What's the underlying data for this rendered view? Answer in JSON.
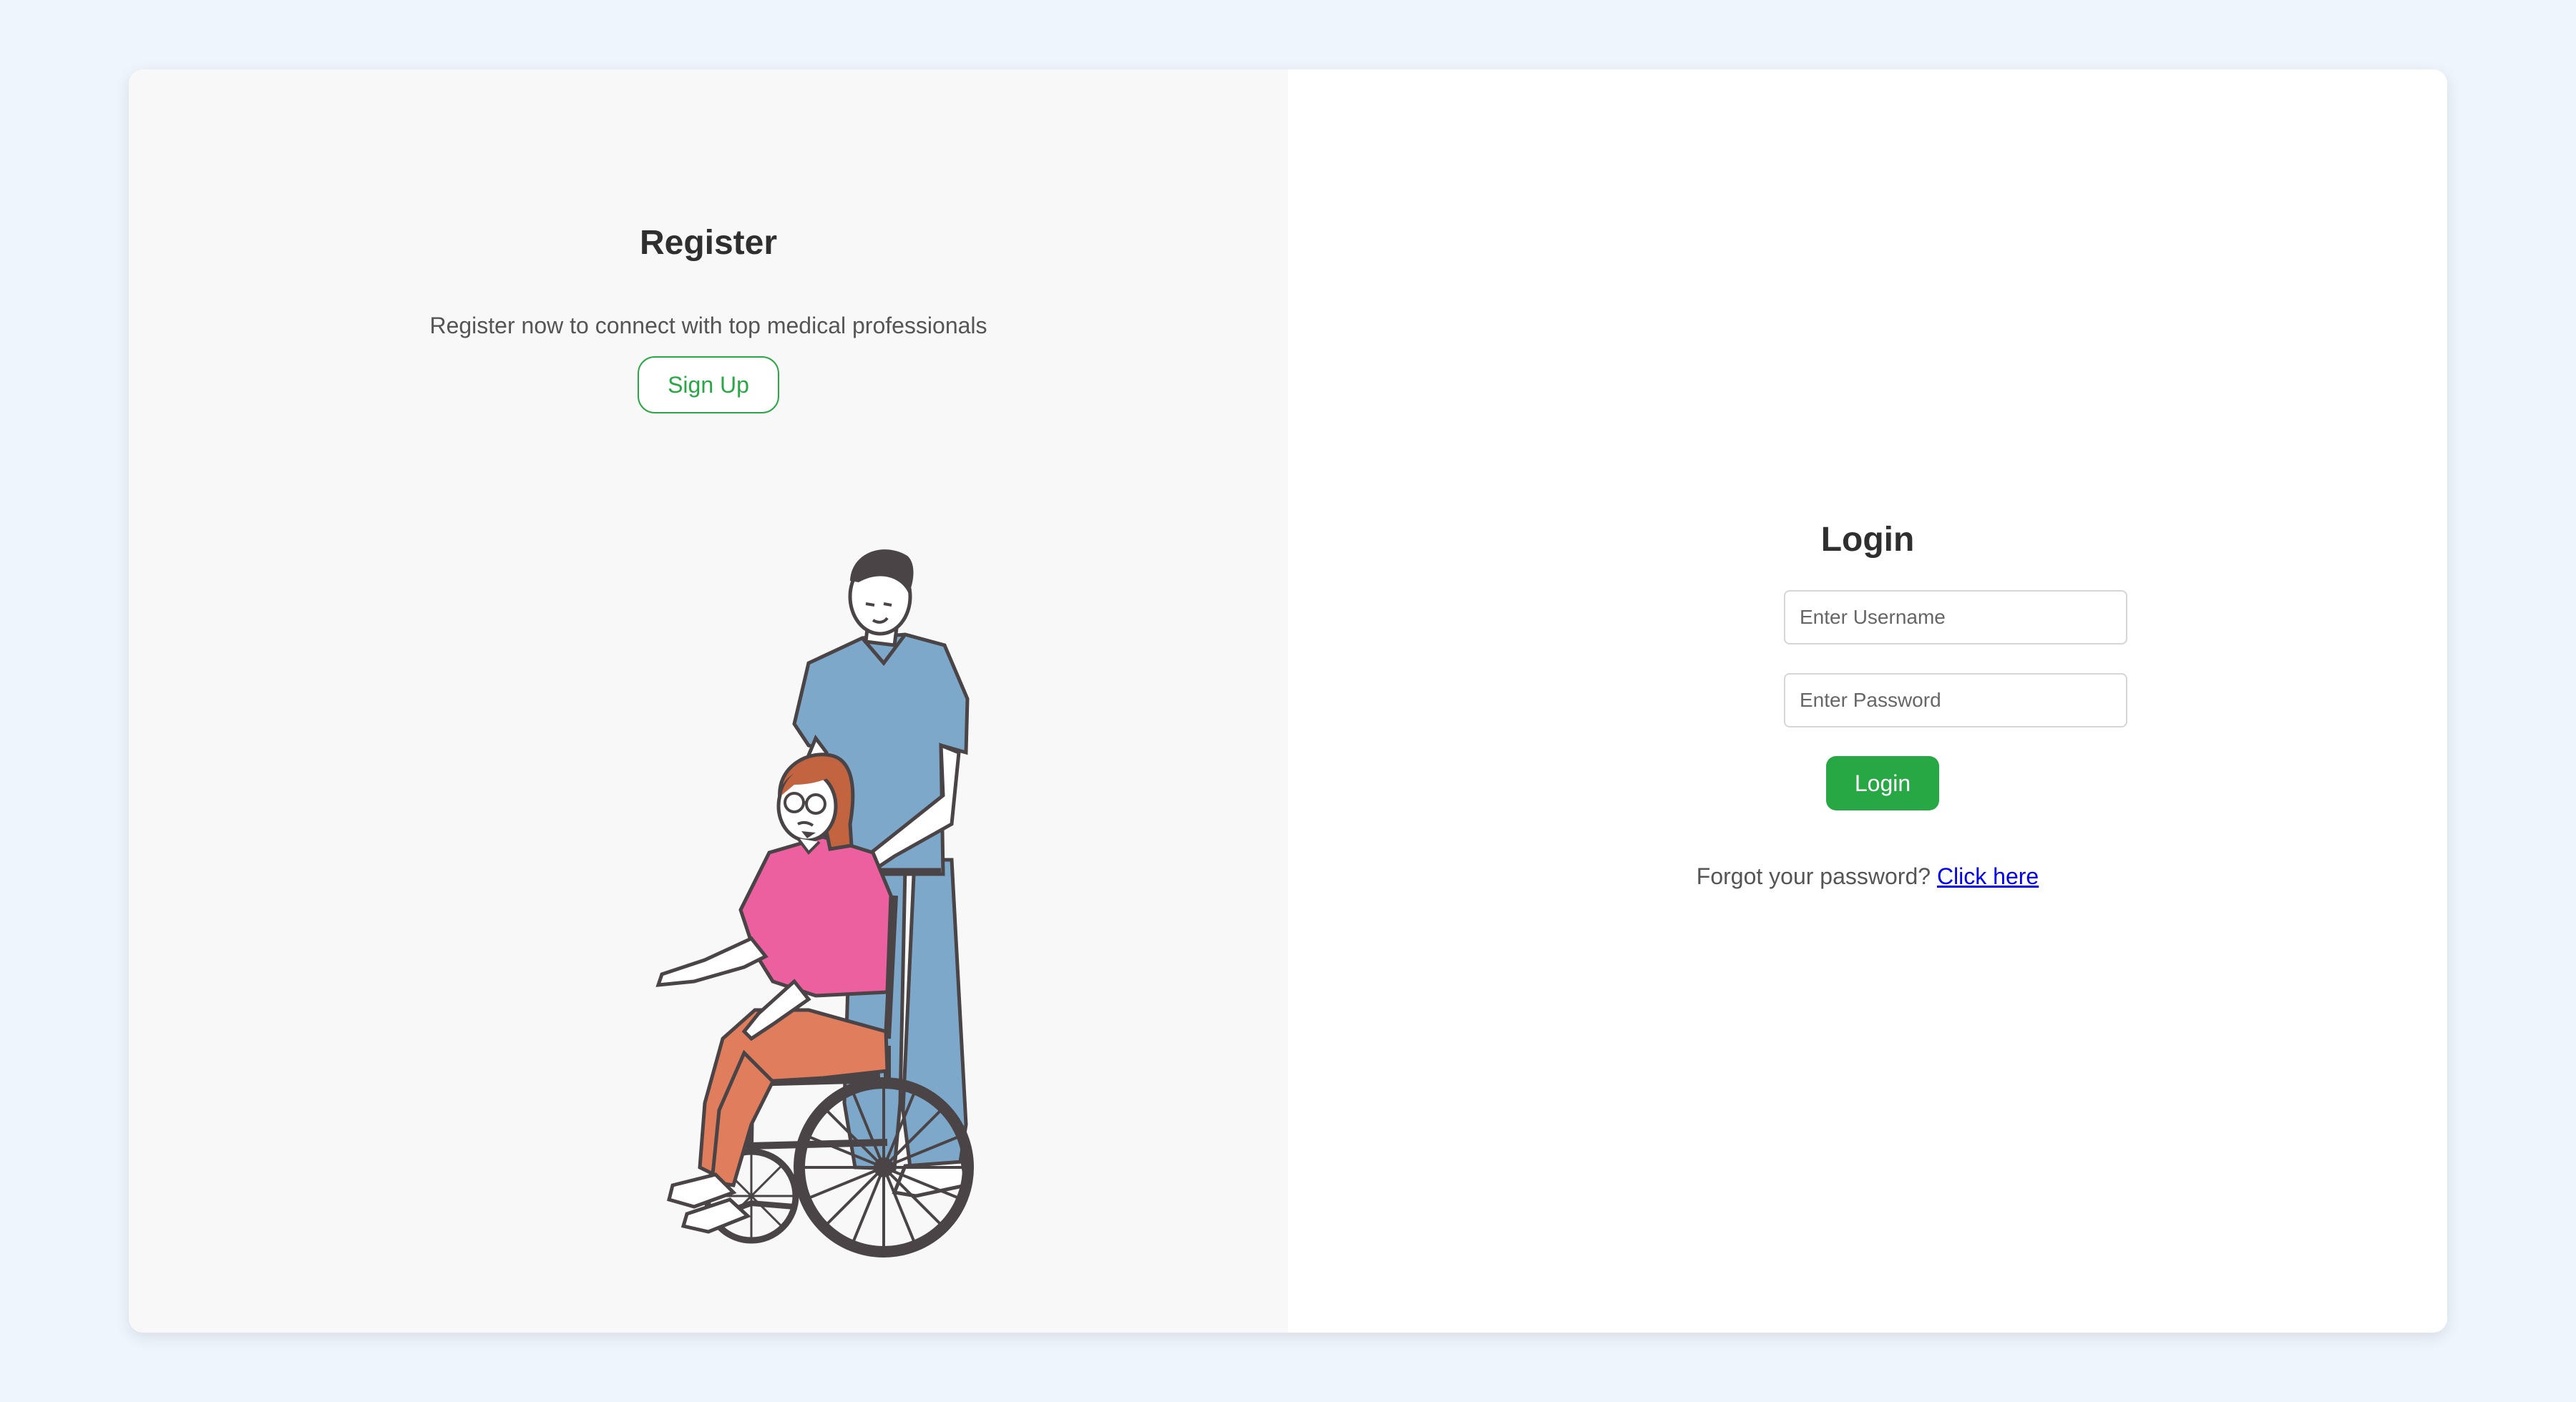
{
  "register": {
    "title": "Register",
    "description": "Register now to connect with top medical professionals",
    "signup_label": "Sign Up"
  },
  "illustration": {
    "icon": "nurse-pushing-wheelchair-illustration",
    "colors": {
      "scrubs": "#7ea8c9",
      "shirt": "#ec609f",
      "pants": "#df7d5c",
      "hair": "#c1643f",
      "outline": "#4a4446"
    }
  },
  "login": {
    "title": "Login",
    "username_placeholder": "Enter Username",
    "password_placeholder": "Enter Password",
    "login_label": "Login",
    "forgot_text": "Forgot your password?",
    "forgot_link": "Click here"
  },
  "colors": {
    "accent": "#28a745",
    "page_background": "#eef5fd",
    "left_panel": "#f8f8f8",
    "link": "#0000ee"
  }
}
